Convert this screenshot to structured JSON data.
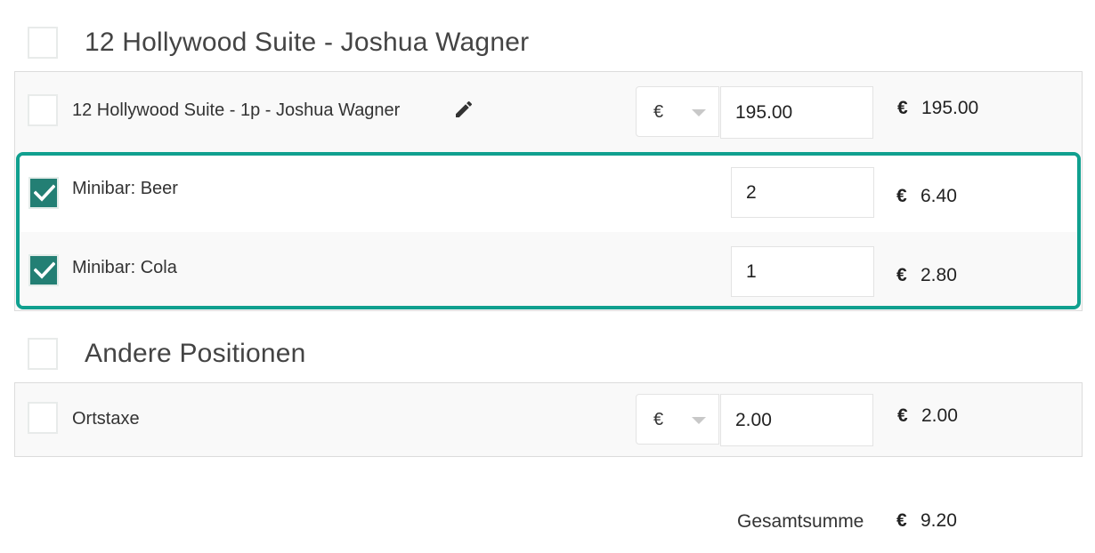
{
  "groups": [
    {
      "title": "12 Hollywood Suite - Joshua Wagner",
      "checked": false,
      "items": [
        {
          "label": "12 Hollywood Suite - 1p - Joshua Wagner",
          "checked": false,
          "editable": true,
          "currency": "€",
          "amount": "195.00",
          "price_currency": "€",
          "price": "195.00"
        },
        {
          "label": "Minibar: Beer",
          "checked": true,
          "quantity": "2",
          "price_currency": "€",
          "price": "6.40"
        },
        {
          "label": "Minibar: Cola",
          "checked": true,
          "quantity": "1",
          "price_currency": "€",
          "price": "2.80"
        }
      ]
    },
    {
      "title": "Andere Positionen",
      "checked": false,
      "items": [
        {
          "label": "Ortstaxe",
          "checked": false,
          "currency": "€",
          "amount": "2.00",
          "price_currency": "€",
          "price": "2.00"
        }
      ]
    }
  ],
  "total": {
    "label": "Gesamtsumme",
    "currency": "€",
    "value": "9.20"
  },
  "colors": {
    "accent": "#10a08f",
    "checkbox_checked": "#237f74",
    "panel_bg": "#f9f9f9"
  },
  "icons": {
    "edit": "pencil-icon",
    "check": "checkmark-icon",
    "dropdown": "caret-down-icon"
  }
}
